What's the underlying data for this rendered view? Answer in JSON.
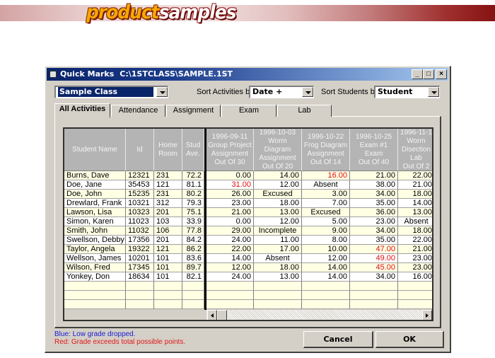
{
  "banner": {
    "logo_part1": "product",
    "logo_part2": "samples"
  },
  "window": {
    "app_name": "Quick Marks",
    "file_path": "C:\\1STCLASS\\SAMPLE.1ST",
    "controls": {
      "minimize": "_",
      "maximize": "□",
      "close": "×"
    }
  },
  "toolbar": {
    "class_select": "Sample Class",
    "sort_activities_label": "Sort Activities by",
    "sort_activities_value": "Date +",
    "sort_students_label": "Sort Students by",
    "sort_students_value": "Student"
  },
  "tabs": [
    {
      "label": "All Activities",
      "active": true
    },
    {
      "label": "Attendance",
      "active": false
    },
    {
      "label": "Assignment",
      "active": false
    },
    {
      "label": "Exam",
      "active": false
    },
    {
      "label": "Lab",
      "active": false
    }
  ],
  "grid": {
    "fixed_headers": [
      "Student Name",
      "Id",
      "Home\nRoom",
      "Stud\nAve."
    ],
    "activity_headers": [
      "1996-09-11\nGroup Project\nAssignment\nOut Of 30",
      "1996-10-03\nWorm Diagram\nAssignment\nOut Of 20",
      "1996-10-22\nFrog Diagram\nAssignment\nOut Of 14",
      "1996-10-25\nExam #1\nExam\nOut Of 40",
      "1996-11-1\nWorm\nDisection\nLab\nOut Of 2"
    ],
    "rows": [
      {
        "name": "Burns, Dave",
        "id": "12321",
        "room": "231",
        "ave": "72.2",
        "marks": [
          "0.00",
          "14.00",
          "16.00",
          "21.00",
          "22.00"
        ],
        "flags": [
          "",
          "",
          "red",
          "",
          ""
        ]
      },
      {
        "name": "Doe, Jane",
        "id": "35453",
        "room": "121",
        "ave": "81.1",
        "marks": [
          "31.00",
          "12.00",
          "Absent",
          "38.00",
          "21.00"
        ],
        "flags": [
          "red",
          "",
          "",
          "",
          ""
        ]
      },
      {
        "name": "Doe, John",
        "id": "15235",
        "room": "231",
        "ave": "80.2",
        "marks": [
          "26.00",
          "Excused",
          "3.00",
          "34.00",
          "18.00"
        ],
        "flags": [
          "",
          "",
          "",
          "",
          ""
        ]
      },
      {
        "name": "Drewlard, Frank",
        "id": "10321",
        "room": "312",
        "ave": "79.3",
        "marks": [
          "23.00",
          "18.00",
          "7.00",
          "35.00",
          "14.00"
        ],
        "flags": [
          "",
          "",
          "",
          "",
          ""
        ]
      },
      {
        "name": "Lawson, Lisa",
        "id": "10323",
        "room": "201",
        "ave": "75.1",
        "marks": [
          "21.00",
          "13.00",
          "Excused",
          "36.00",
          "13.00"
        ],
        "flags": [
          "",
          "",
          "",
          "",
          ""
        ]
      },
      {
        "name": "Simon, Karen",
        "id": "11023",
        "room": "103",
        "ave": "33.9",
        "marks": [
          "0.00",
          "12.00",
          "5.00",
          "23.00",
          "Absent"
        ],
        "flags": [
          "",
          "",
          "",
          "",
          ""
        ]
      },
      {
        "name": "Smith, John",
        "id": "11032",
        "room": "106",
        "ave": "77.8",
        "marks": [
          "29.00",
          "Incomplete",
          "9.00",
          "34.00",
          "18.00"
        ],
        "flags": [
          "",
          "",
          "",
          "",
          ""
        ]
      },
      {
        "name": "Swellson, Debby",
        "id": "17356",
        "room": "201",
        "ave": "84.2",
        "marks": [
          "24.00",
          "11.00",
          "8.00",
          "35.00",
          "22.00"
        ],
        "flags": [
          "",
          "",
          "",
          "",
          ""
        ]
      },
      {
        "name": "Taylor, Angela",
        "id": "19322",
        "room": "121",
        "ave": "86.2",
        "marks": [
          "22.00",
          "17.00",
          "10.00",
          "47.00",
          "21.00"
        ],
        "flags": [
          "",
          "",
          "",
          "red",
          ""
        ]
      },
      {
        "name": "Wellson, James",
        "id": "10201",
        "room": "101",
        "ave": "83.6",
        "marks": [
          "14.00",
          "Absent",
          "12.00",
          "49.00",
          "23.00"
        ],
        "flags": [
          "",
          "",
          "",
          "red",
          ""
        ]
      },
      {
        "name": "Wilson, Fred",
        "id": "17345",
        "room": "101",
        "ave": "89.7",
        "marks": [
          "12.00",
          "18.00",
          "14.00",
          "45.00",
          "23.00"
        ],
        "flags": [
          "",
          "",
          "",
          "red",
          ""
        ]
      },
      {
        "name": "Yonkey, Don",
        "id": "18634",
        "room": "101",
        "ave": "82.1",
        "marks": [
          "24.00",
          "13.00",
          "14.00",
          "34.00",
          "16.00"
        ],
        "flags": [
          "",
          "",
          "",
          "",
          ""
        ]
      }
    ],
    "empty_rows": 3
  },
  "legend": {
    "blue": "Blue: Low grade dropped.",
    "red": "Red: Grade exceeds total possible points."
  },
  "buttons": {
    "cancel": "Cancel",
    "ok": "OK"
  },
  "colors": {
    "title_start": "#0a246a",
    "title_end": "#a6caf0",
    "over_max": "#e01010",
    "dropped": "#1010e0",
    "row_tint": "#ffffe4"
  }
}
